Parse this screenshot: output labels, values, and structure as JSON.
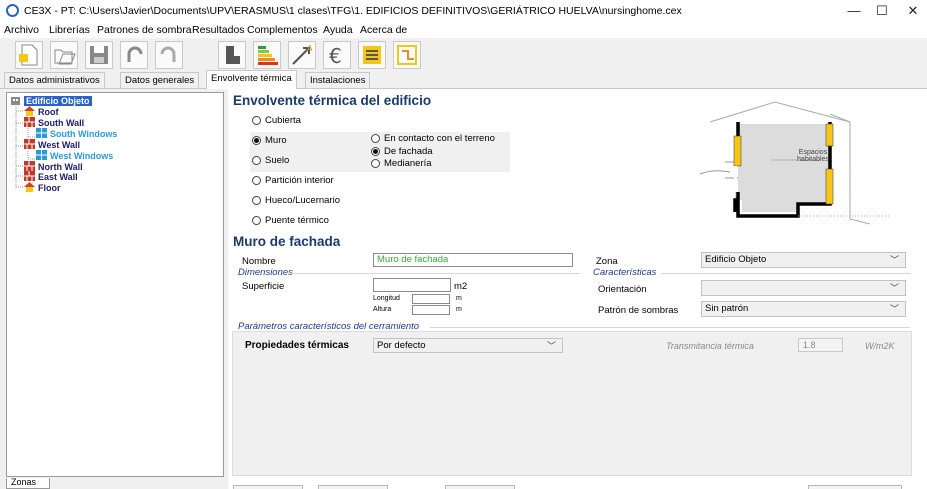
{
  "window": {
    "title": "CE3X - PT: C:\\Users\\Javier\\Documents\\UPV\\ERASMUS\\1 clases\\TFG\\1. EDIFICIOS DEFINITIVOS\\GERIÁTRICO HUELVA\\nursinghome.cex",
    "minimize": "—",
    "maximize": "☐",
    "close": "✕"
  },
  "menu": [
    "Archivo",
    "Librerías",
    "Patrones de sombra",
    "Resultados",
    "Complementos",
    "Ayuda",
    "Acerca de"
  ],
  "toolbar_icons": [
    "new-file-icon",
    "open-folder-icon",
    "save-icon",
    "undo-icon",
    "redo-icon",
    "import-icon",
    "energy-rating-icon",
    "improvement-measures-icon",
    "euro-icon",
    "report-icon",
    "plan-icon"
  ],
  "tabs": [
    "Datos administrativos",
    "Datos generales",
    "Envolvente térmica",
    "Instalaciones"
  ],
  "active_tab": "Envolvente térmica",
  "tree": {
    "root": "Edificio Objeto",
    "nodes": [
      {
        "label": "Roof",
        "type": "roof"
      },
      {
        "label": "South Wall",
        "type": "wall"
      },
      {
        "label": "South Windows",
        "type": "window"
      },
      {
        "label": "West Wall",
        "type": "wall"
      },
      {
        "label": "West Windows",
        "type": "window"
      },
      {
        "label": "North Wall",
        "type": "wall"
      },
      {
        "label": "East Wall",
        "type": "wall"
      },
      {
        "label": "Floor",
        "type": "roof"
      }
    ],
    "bottom_tab": "Zonas"
  },
  "envelope": {
    "title": "Envolvente térmica del edificio",
    "options": [
      "Cubierta",
      "Muro",
      "Suelo",
      "Partición interior",
      "Hueco/Lucernario",
      "Puente térmico"
    ],
    "selected": "Muro",
    "wall_suboptions": [
      "En contacto con el terreno",
      "De fachada",
      "Medianería"
    ],
    "wall_selected": "De fachada",
    "diagram_label": "Espacios habitables"
  },
  "form": {
    "title": "Muro de fachada",
    "nombre_label": "Nombre",
    "nombre_value": "Muro de fachada",
    "zona_label": "Zona",
    "zona_value": "Edificio Objeto",
    "dimensiones_label": "Dimensiones",
    "superficie_label": "Superficie",
    "superficie_unit": "m2",
    "longitud_label": "Longitud",
    "longitud_unit": "m",
    "altura_label": "Altura",
    "altura_unit": "m",
    "caracteristicas_label": "Características",
    "orientacion_label": "Orientación",
    "orientacion_value": "",
    "patron_label": "Patrón de sombras",
    "patron_value": "Sin patrón",
    "parametros_label": "Parámetros característicos del cerramiento",
    "propiedades_label": "Propiedades térmicas",
    "propiedades_value": "Por defecto",
    "transmitancia_label": "Transmitancia térmica",
    "transmitancia_value": "1.8",
    "transmitancia_unit": "W/m2K"
  },
  "colors": {
    "title_blue": "#1a3a6c",
    "selection": "#2a63c7",
    "window_blue": "#2b9bd8",
    "nombre_green": "#3aa53a",
    "wall_yellow": "#f5c518"
  }
}
